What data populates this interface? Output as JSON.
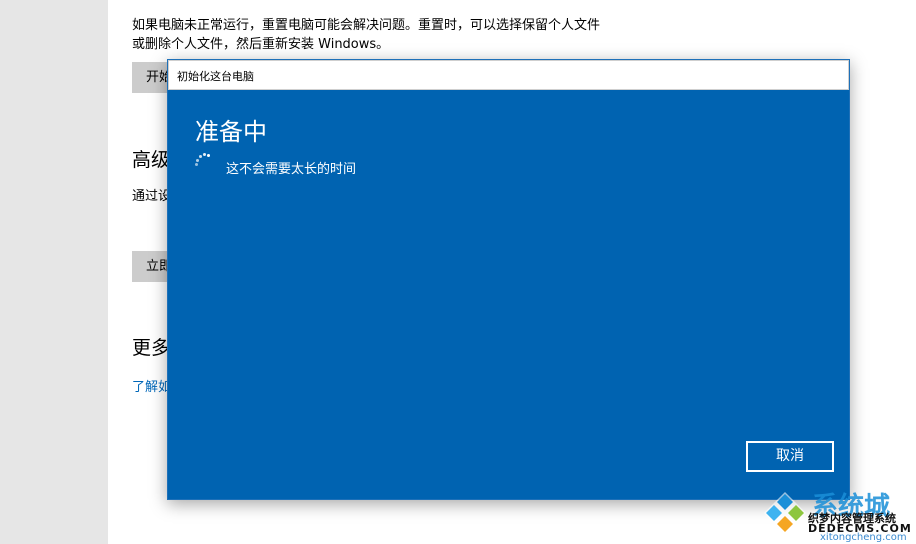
{
  "settings": {
    "reset_description": "如果电脑未正常运行，重置电脑可能会解决问题。重置时，可以选择保留个人文件或删除个人文件，然后重新安装 Windows。",
    "start_button": "开始",
    "advanced_heading": "高级",
    "advanced_description": "通过设备 Windows 脑。",
    "restart_button": "立即",
    "more_heading": "更多",
    "learn_more_link": "了解如"
  },
  "dialog": {
    "title": "初始化这台电脑",
    "heading": "准备中",
    "status_text": "这不会需要太长的时间",
    "cancel_button": "取消"
  },
  "watermark": {
    "brand": "系统城",
    "line1": "织梦内容管理系统",
    "line2": "DEDECMS.COM",
    "line3": "xitongcheng.com"
  }
}
